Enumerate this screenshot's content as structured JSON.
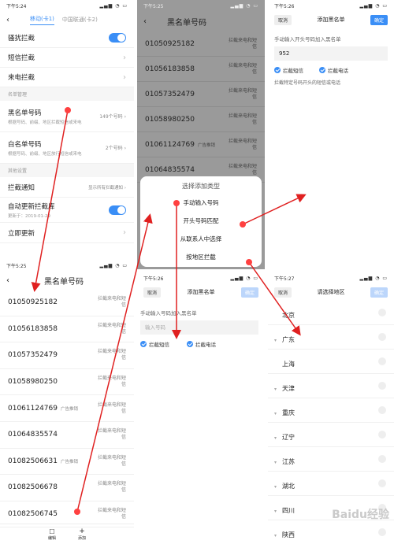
{
  "settings": {
    "time": "下午5:24",
    "tabs": [
      "移动(卡1)",
      "中国联通(卡2)"
    ],
    "rows": {
      "harass": "骚扰拦截",
      "sms": "短信拦截",
      "call": "来电拦截"
    },
    "section_list": "名单管理",
    "blacklist": {
      "title": "黑名单号码",
      "desc": "根据号码、前缀、地区拦截短信或来电",
      "count": "149个号码"
    },
    "whitelist": {
      "title": "白名单号码",
      "desc": "根据号码、前缀、地区放行短信或来电",
      "count": "2个号码"
    },
    "section_other": "其他设置",
    "notify": {
      "title": "拦截通知",
      "value": "显示所有拦截通知"
    },
    "auto": {
      "title": "自动更新拦截库",
      "desc": "更新于：2019-01-29"
    },
    "update_now": "立即更新"
  },
  "blacklist_page": {
    "time": "下午5:25",
    "title": "黑名单号码",
    "default_label": "拦截来电和短信",
    "ad_label": "广告推销",
    "numbers": [
      "01050925182",
      "01056183858",
      "01057352479",
      "01058980250",
      "01061124769",
      "01064835574",
      "01082506631",
      "01082506678",
      "01082506745"
    ],
    "ad_rows": [
      4,
      6
    ],
    "bottom": {
      "edit": "编辑",
      "add": "添加"
    }
  },
  "dialog_page": {
    "time": "下午5:25",
    "title": "黑名单号码",
    "numbers": [
      "01050925182",
      "01056183858",
      "01057352479",
      "01058980250",
      "01061124769",
      "01064835574"
    ],
    "label": "拦截来电和短信",
    "ad_label": "广告推销",
    "dialog_title": "选择添加类型",
    "options": [
      "手动输入号码",
      "开头号码匹配",
      "从联系人中选择",
      "按地区拦截"
    ]
  },
  "prefix_page": {
    "time": "下午5:26",
    "cancel": "取消",
    "title": "添加黑名单",
    "confirm": "确定",
    "hint": "手动输入开头号码加入黑名单",
    "value": "952",
    "chk_sms": "拦截短信",
    "chk_call": "拦截电话",
    "note": "拦截特定号码开头的短信或电话"
  },
  "manual_page": {
    "time": "下午5:26",
    "cancel": "取消",
    "title": "添加黑名单",
    "confirm": "确定",
    "hint": "手动输入号码加入黑名单",
    "placeholder": "输入号码",
    "chk_sms": "拦截短信",
    "chk_call": "拦截电话"
  },
  "region_page": {
    "time": "下午5:27",
    "cancel": "取消",
    "title": "请选择地区",
    "confirm": "确定",
    "regions": [
      "北京",
      "广东",
      "上海",
      "天津",
      "重庆",
      "辽宁",
      "江苏",
      "湖北",
      "四川",
      "陕西"
    ],
    "expandable": [
      1,
      3,
      4,
      5,
      6,
      7,
      8,
      9
    ]
  },
  "watermark": "Baidu经验",
  "colors": {
    "accent": "#3a8ef6",
    "arrow": "#e02020"
  }
}
